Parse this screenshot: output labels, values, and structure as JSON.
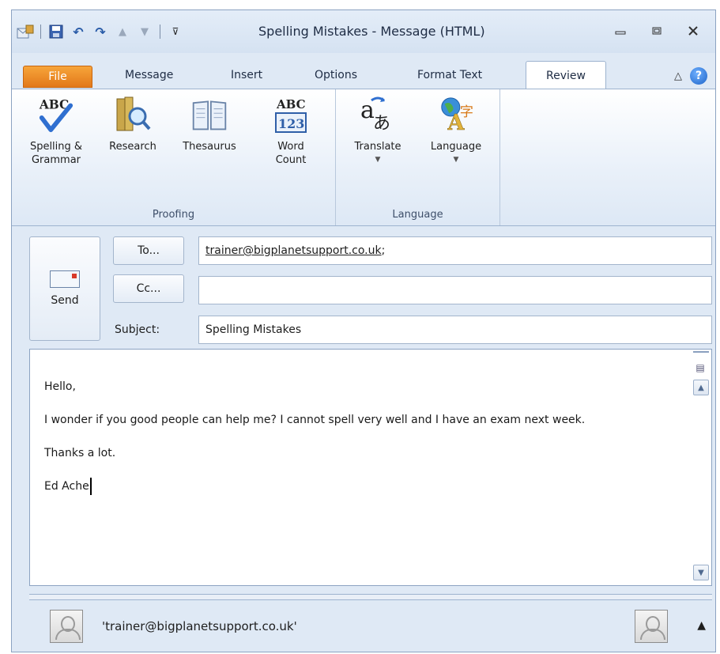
{
  "window": {
    "title": "Spelling Mistakes - Message (HTML)",
    "qat_icons": [
      "outlook-app-icon",
      "save-icon",
      "undo-icon",
      "redo-icon",
      "up-arrow-icon",
      "down-arrow-icon",
      "customize-qat-icon"
    ],
    "buttons": [
      "minimize",
      "restore",
      "close"
    ]
  },
  "tabs": [
    {
      "label": "File"
    },
    {
      "label": "Message"
    },
    {
      "label": "Insert"
    },
    {
      "label": "Options"
    },
    {
      "label": "Format Text"
    },
    {
      "label": "Review",
      "selected": true
    }
  ],
  "ribbon": {
    "proofing": {
      "label": "Proofing",
      "spelling_line1": "Spelling &",
      "spelling_line2": "Grammar",
      "research": "Research",
      "thesaurus": "Thesaurus",
      "wordcount_line1": "Word",
      "wordcount_line2": "Count",
      "abc_text": "ABC",
      "num_text": "123"
    },
    "language": {
      "label": "Language",
      "translate": "Translate",
      "language": "Language"
    }
  },
  "compose": {
    "send": "Send",
    "to_button": "To...",
    "cc_button": "Cc...",
    "subject_label": "Subject:",
    "to_value": "trainer@bigplanetsupport.co.uk",
    "to_suffix": ";",
    "cc_value": "",
    "subject_value": "Spelling Mistakes"
  },
  "body": {
    "greeting": "Hello,",
    "para1": "I wonder if you good people can help me? I cannot spell very well and I have an exam next week.",
    "para2": "Thanks a lot.",
    "signature": "Ed Ache"
  },
  "people_pane": {
    "name": "'trainer@bigplanetsupport.co.uk'"
  },
  "colors": {
    "file_tab": "#e2781a",
    "window_bg": "#dfe9f5",
    "accent": "#1e64c8"
  }
}
